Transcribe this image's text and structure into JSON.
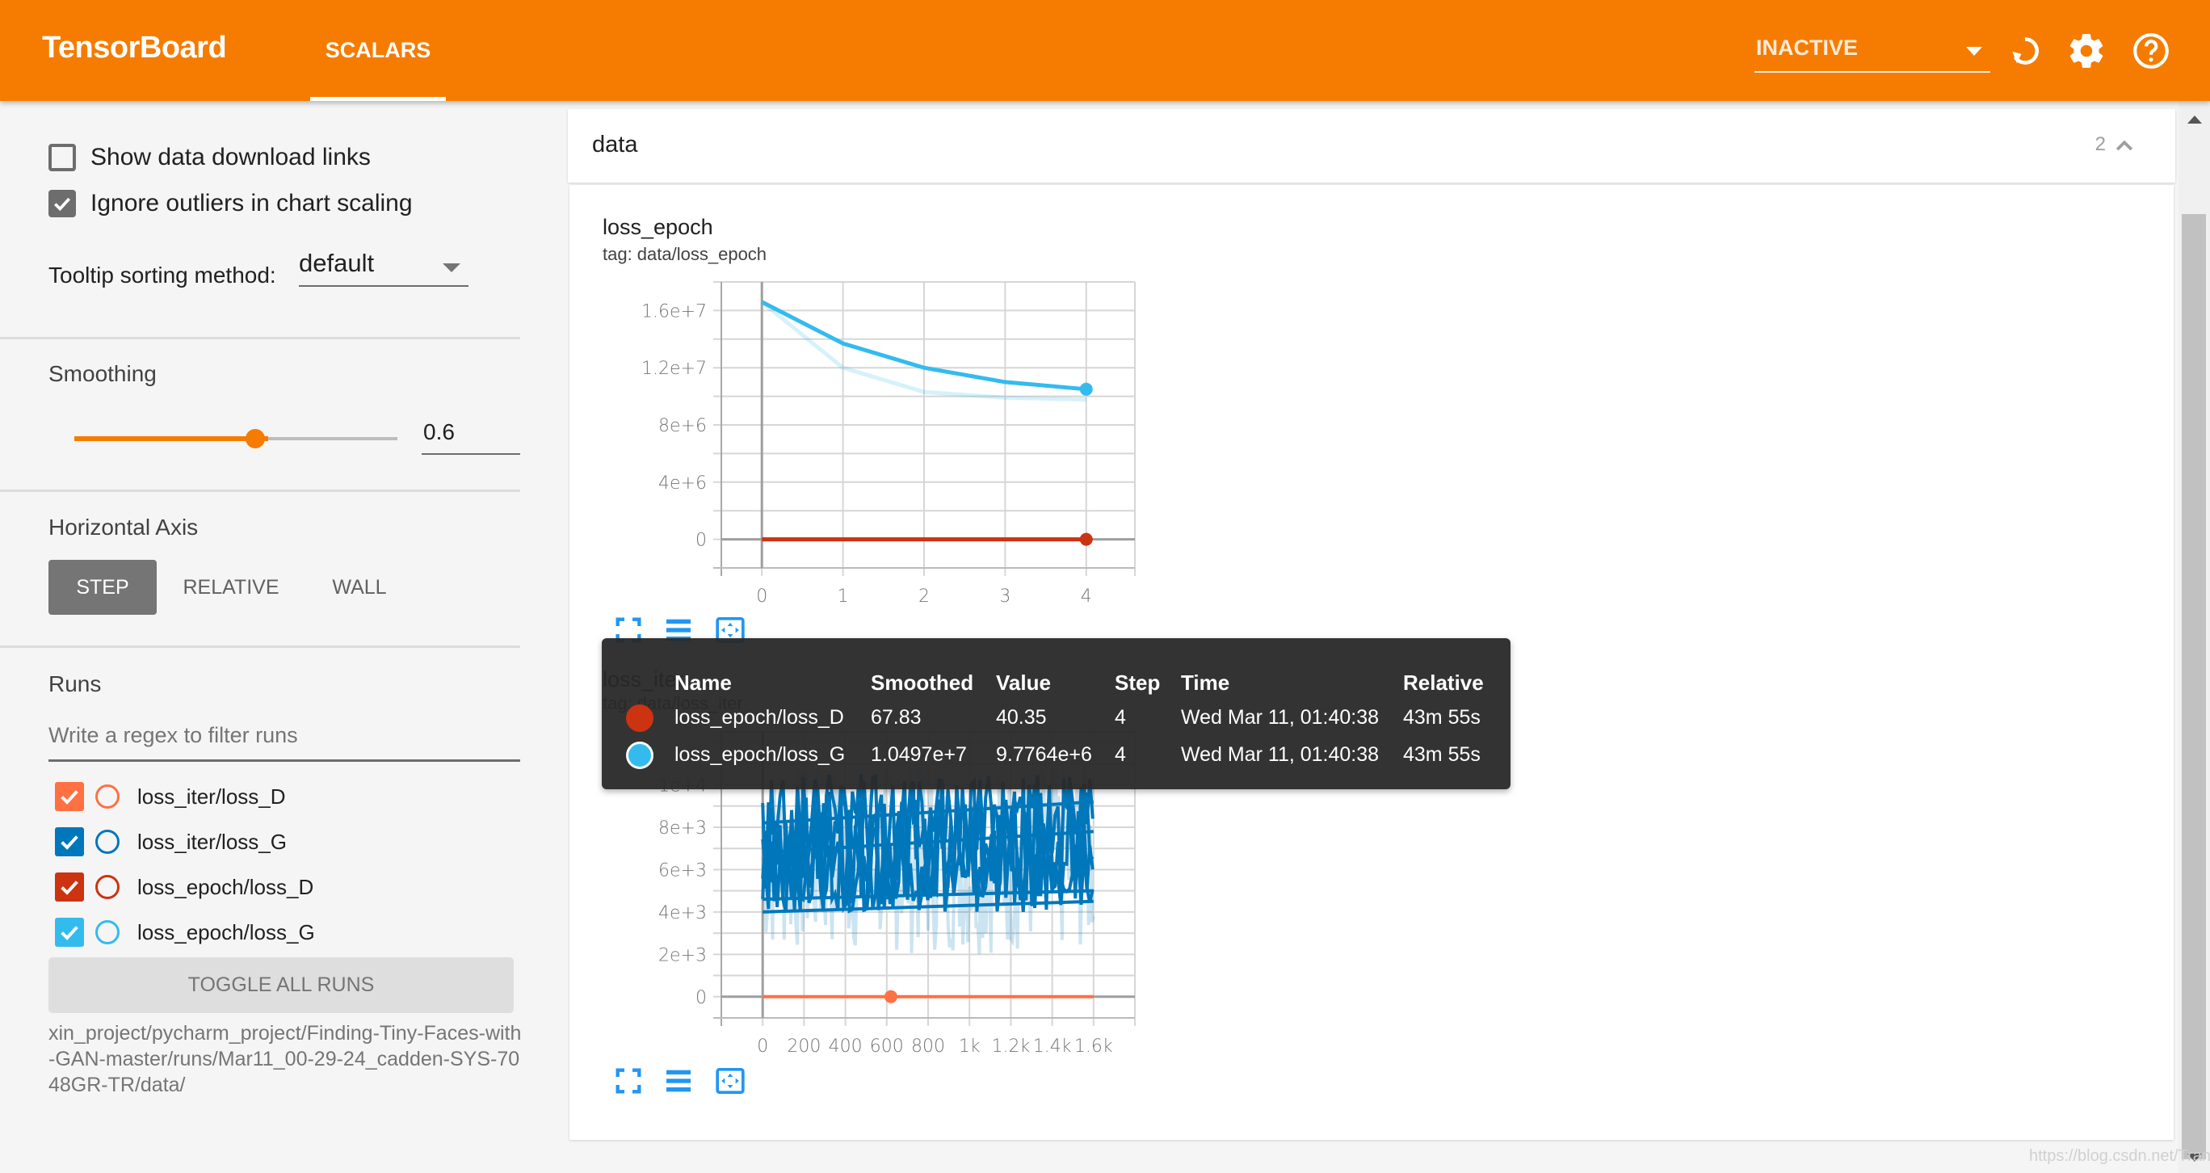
{
  "header": {
    "brand": "TensorBoard",
    "tabs": [
      {
        "label": "SCALARS",
        "active": true
      }
    ],
    "reload_select": {
      "value": "INACTIVE"
    },
    "icons": [
      "reload-icon",
      "settings-icon",
      "help-icon"
    ],
    "brand_color": "#f57c00"
  },
  "sidebar": {
    "show_download_links": {
      "label": "Show data download links",
      "checked": false
    },
    "ignore_outliers": {
      "label": "Ignore outliers in chart scaling",
      "checked": true
    },
    "tooltip_sorting": {
      "label": "Tooltip sorting method:",
      "value": "default"
    },
    "smoothing": {
      "title": "Smoothing",
      "value": "0.6",
      "fraction": 0.6
    },
    "horizontal_axis": {
      "title": "Horizontal Axis",
      "options": [
        "STEP",
        "RELATIVE",
        "WALL"
      ],
      "selected": "STEP"
    },
    "runs": {
      "title": "Runs",
      "filter_placeholder": "Write a regex to filter runs",
      "items": [
        {
          "label": "loss_iter/loss_D",
          "checked": true,
          "color": "#ff7043"
        },
        {
          "label": "loss_iter/loss_G",
          "checked": true,
          "color": "#0077bb"
        },
        {
          "label": "loss_epoch/loss_D",
          "checked": true,
          "color": "#cc3311"
        },
        {
          "label": "loss_epoch/loss_G",
          "checked": true,
          "color": "#33bbee"
        }
      ],
      "toggle_all_label": "TOGGLE ALL RUNS",
      "path": "xin_project/pycharm_project/Finding-Tiny-Faces-with-GAN-master/runs/Mar11_00-29-24_cadden-SYS-7048GR-TR/data/"
    }
  },
  "main": {
    "group": {
      "title": "data",
      "count": "2"
    },
    "charts": [
      {
        "title": "loss_epoch",
        "tag": "tag: data/loss_epoch"
      },
      {
        "title": "loss_iter",
        "tag": "tag: data/loss_iter"
      }
    ]
  },
  "chart_data": [
    {
      "type": "line",
      "title": "loss_epoch",
      "subtitle": "tag: data/loss_epoch",
      "xlabel": "",
      "ylabel": "",
      "x_ticks": [
        "0",
        "1",
        "2",
        "3",
        "4"
      ],
      "y_ticks": [
        "0",
        "4e+6",
        "8e+6",
        "1.2e+7",
        "1.6e+7"
      ],
      "xlim": [
        -0.5,
        4.6
      ],
      "ylim": [
        -2000000,
        18000000
      ],
      "grid": true,
      "x": [
        0,
        1,
        2,
        3,
        4
      ],
      "series": [
        {
          "name": "loss_epoch/loss_G",
          "color": "#33bbee",
          "smoothed": [
            16600000,
            13700000,
            12000000,
            11000000,
            10497000
          ],
          "raw": [
            16600000,
            12000000,
            10300000,
            9900000,
            9776400
          ],
          "marker_at_step": 4
        },
        {
          "name": "loss_epoch/loss_D",
          "color": "#cc3311",
          "smoothed": [
            120,
            95,
            80,
            72,
            67.83
          ],
          "raw": [
            120,
            70,
            60,
            50,
            40.35
          ],
          "marker_at_step": 4
        }
      ]
    },
    {
      "type": "line",
      "title": "loss_iter",
      "subtitle": "tag: data/loss_iter",
      "xlabel": "",
      "ylabel": "",
      "x_ticks": [
        "0",
        "200",
        "400",
        "600",
        "800",
        "1k",
        "1.2k",
        "1.4k",
        "1.6k"
      ],
      "y_ticks": [
        "0",
        "2e+3",
        "4e+3",
        "6e+3",
        "8e+3",
        "1e+4"
      ],
      "xlim": [
        -200,
        1800
      ],
      "ylim": [
        -1000,
        12500
      ],
      "grid": true,
      "series": [
        {
          "name": "loss_iter/loss_G",
          "color": "#0077bb",
          "smoothed_range": [
            4000,
            10500
          ],
          "raw_range": [
            2000,
            11000
          ],
          "x_range": [
            0,
            1600
          ]
        },
        {
          "name": "loss_iter/loss_D",
          "color": "#ff7043",
          "value": 0,
          "x_range": [
            0,
            1600
          ],
          "marker_at_step": 620
        }
      ]
    }
  ],
  "tooltip": {
    "headers": [
      "Name",
      "Smoothed",
      "Value",
      "Step",
      "Time",
      "Relative"
    ],
    "rows": [
      {
        "color": "#cc3311",
        "name": "loss_epoch/loss_D",
        "smoothed": "67.83",
        "value": "40.35",
        "step": "4",
        "time": "Wed Mar 11, 01:40:38",
        "relative": "43m 55s"
      },
      {
        "color": "#33bbee",
        "name": "loss_epoch/loss_G",
        "smoothed": "1.0497e+7",
        "value": "9.7764e+6",
        "step": "4",
        "time": "Wed Mar 11, 01:40:38",
        "relative": "43m 55s"
      }
    ]
  },
  "watermark": "https://blog.csdn.net/Trancelo"
}
